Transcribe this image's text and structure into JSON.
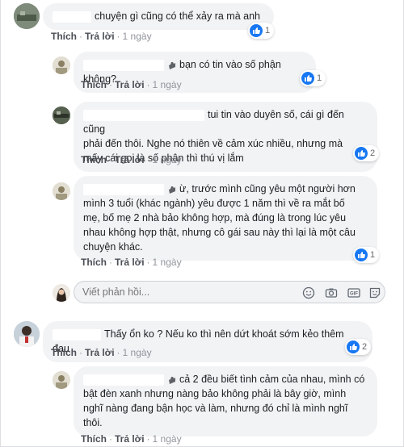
{
  "actions": {
    "like": "Thích",
    "reply": "Trả lời"
  },
  "comments": [
    {
      "text": "chuyện gì cũng có thể xảy ra mà anh",
      "time": "1 ngày",
      "likes": "1"
    },
    {
      "text": "bạn có tin vào số phận không?",
      "time": "1 ngày",
      "likes": "1"
    },
    {
      "lines": [
        "tui tin vào duyên số, cái gì đến cũng",
        "phải đến thôi. Nghe nó thiên về cảm xúc nhiều, nhưng mà",
        "mấy cái gọi là số phận thì thú vị lắm"
      ],
      "time": "1 ngày",
      "likes": "2"
    },
    {
      "lines": [
        "ừ, trước mình cũng yêu một người hơn",
        "mình 3 tuổi (khác ngành) yêu được 1 năm thì về ra mắt bố",
        "mẹ, bố mẹ 2 nhà bảo không hợp, mà đúng là trong lúc yêu",
        "nhau không hợp thật, nhưng cô gái sau này thì lại là một câu",
        "chuyện khác."
      ],
      "time": "1 ngày",
      "likes": "1"
    },
    {
      "text": "Thấy ổn ko ? Nếu ko thì nên dứt khoát sớm kẻo thêm đau",
      "time": "1 ngày",
      "likes": "2"
    },
    {
      "lines": [
        "cả 2 đều biết tình cảm của nhau, mình có",
        "bật đèn xanh nhưng nàng bảo không phải là bây giờ, mình",
        "nghĩ nàng đang bận học và làm, nhưng đó chỉ là mình nghĩ",
        "thôi."
      ],
      "time": "1 ngày"
    }
  ],
  "reply_box": {
    "placeholder": "Viết phản hồi..."
  },
  "colors": {
    "link": "#4b4f56",
    "bubble": "#f2f3f5",
    "like_blue": "#1877f2"
  }
}
